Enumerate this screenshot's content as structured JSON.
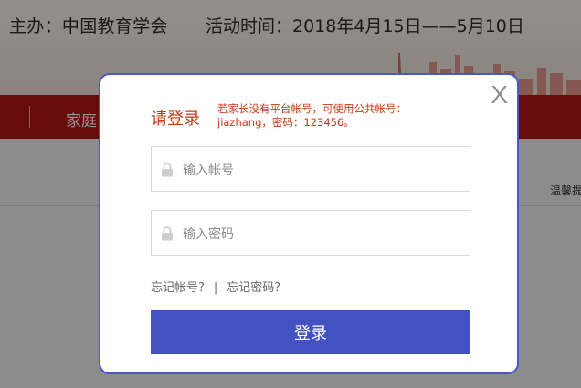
{
  "background": {
    "organizer": "主办：中国教育学会",
    "event_time": "活动时间：2018年4月15日——5月10日",
    "nav_item": "家庭",
    "hint": "温馨提"
  },
  "modal": {
    "title": "请登录",
    "notice": "若家长没有平台帐号，可使用公共帐号：jiazhang，密码：123456。",
    "close_label": "X",
    "account_placeholder": "输入帐号",
    "password_placeholder": "输入密码",
    "forgot_account": "忘记帐号?",
    "separator": "|",
    "forgot_password": "忘记密码?",
    "login_button": "登录"
  },
  "colors": {
    "accent": "#4452c1",
    "title_red": "#c63a1a",
    "nav_red": "#b31414"
  }
}
